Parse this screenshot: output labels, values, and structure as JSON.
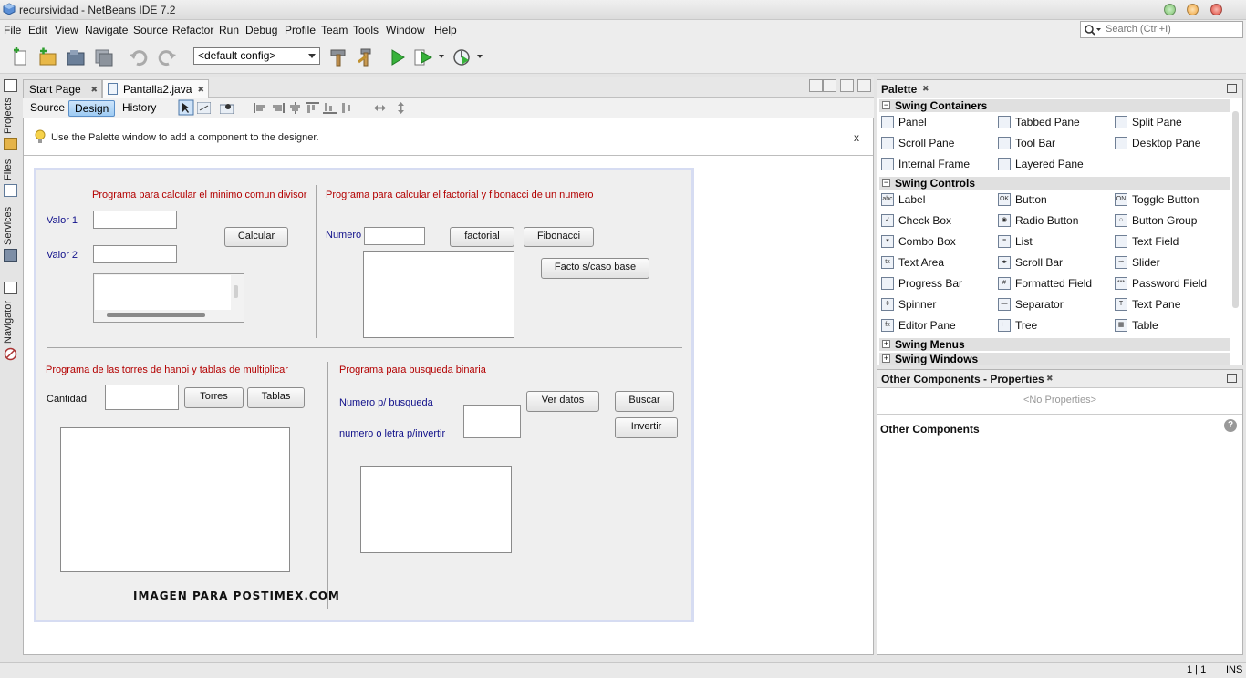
{
  "window": {
    "title": "recursividad - NetBeans IDE 7.2"
  },
  "menu": [
    "File",
    "Edit",
    "View",
    "Navigate",
    "Source",
    "Refactor",
    "Run",
    "Debug",
    "Profile",
    "Team",
    "Tools",
    "Window",
    "Help"
  ],
  "search": {
    "placeholder": "Search (Ctrl+I)"
  },
  "toolbar": {
    "config": "<default config>"
  },
  "side_tabs": [
    "Projects",
    "Files",
    "Services",
    "Navigator"
  ],
  "tabs": [
    {
      "label": "Start Page"
    },
    {
      "label": "Pantalla2.java"
    }
  ],
  "views": {
    "source": "Source",
    "design": "Design",
    "history": "History"
  },
  "hint": {
    "text": "Use the Palette window to add a component to the designer.",
    "close": "x"
  },
  "form": {
    "mcd": {
      "title": "Programa para calcular el minimo comun divisor",
      "valor1": "Valor 1",
      "valor2": "Valor 2",
      "calcular": "Calcular"
    },
    "factorial": {
      "title": "Programa para calcular el factorial y fibonacci de un numero",
      "numero": "Numero",
      "factorial_btn": "factorial",
      "fibonacci_btn": "Fibonacci",
      "facto_btn": "Facto s/caso base"
    },
    "hanoi": {
      "title": "Programa de las torres de hanoi y tablas de multiplicar",
      "cantidad": "Cantidad",
      "torres_btn": "Torres",
      "tablas_btn": "Tablas"
    },
    "binaria": {
      "title": "Programa para busqueda binaria",
      "numero_busqueda": "Numero p/ busqueda",
      "numero_invertir": "numero o letra p/invertir",
      "ver_datos_btn": "Ver datos",
      "buscar_btn": "Buscar",
      "invertir_btn": "Invertir"
    },
    "watermark": "IMAGEN PARA POSTIMEX.COM"
  },
  "palette": {
    "title": "Palette",
    "categories": {
      "containers": "Swing Containers",
      "controls": "Swing Controls",
      "menus": "Swing Menus",
      "windows": "Swing Windows"
    },
    "containers": [
      "Panel",
      "Tabbed Pane",
      "Split Pane",
      "Scroll Pane",
      "Tool Bar",
      "Desktop Pane",
      "Internal Frame",
      "Layered Pane"
    ],
    "controls": [
      "Label",
      "Button",
      "Toggle Button",
      "Check Box",
      "Radio Button",
      "Button Group",
      "Combo Box",
      "List",
      "Text Field",
      "Text Area",
      "Scroll Bar",
      "Slider",
      "Progress Bar",
      "Formatted Field",
      "Password Field",
      "Spinner",
      "Separator",
      "Text Pane",
      "Editor Pane",
      "Tree",
      "Table"
    ]
  },
  "properties": {
    "title": "Other Components - Properties",
    "empty": "<No Properties>",
    "section": "Other Components",
    "help": "?"
  },
  "status": {
    "position": "1 | 1",
    "mode": "INS"
  }
}
